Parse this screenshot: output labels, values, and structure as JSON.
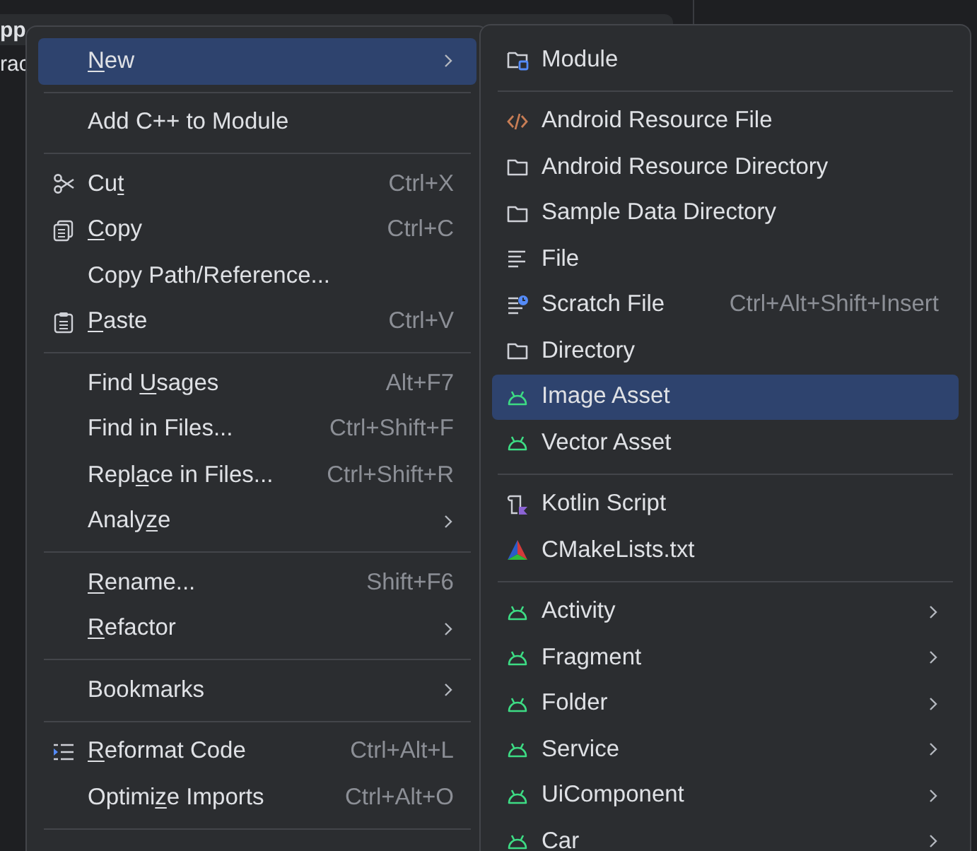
{
  "background": {
    "texts": [
      "pp",
      "rac"
    ]
  },
  "context_menu": {
    "items": [
      {
        "kind": "plain",
        "mnemonic": "N",
        "label_after": "ew",
        "selected": true,
        "submenu": true
      },
      {
        "kind": "separator"
      },
      {
        "kind": "plain",
        "label": "Add C++ to Module",
        "selected": false
      },
      {
        "kind": "separator"
      },
      {
        "kind": "scissors",
        "label_before": "Cu",
        "mnemonic": "t",
        "shortcut": "Ctrl+X",
        "selected": false
      },
      {
        "kind": "copy",
        "mnemonic": "C",
        "label_after": "opy",
        "shortcut": "Ctrl+C",
        "selected": false
      },
      {
        "kind": "plain",
        "label": "Copy Path/Reference...",
        "selected": false
      },
      {
        "kind": "clipboard",
        "mnemonic": "P",
        "label_after": "aste",
        "shortcut": "Ctrl+V",
        "selected": false
      },
      {
        "kind": "separator"
      },
      {
        "kind": "plain",
        "label_before": "Find ",
        "mnemonic": "U",
        "label_after": "sages",
        "shortcut": "Alt+F7",
        "selected": false
      },
      {
        "kind": "plain",
        "label": "Find in Files...",
        "shortcut": "Ctrl+Shift+F",
        "selected": false
      },
      {
        "kind": "plain",
        "label_before": "Repl",
        "mnemonic": "a",
        "label_after": "ce in Files...",
        "shortcut": "Ctrl+Shift+R",
        "selected": false
      },
      {
        "kind": "plain",
        "label_before": "Analy",
        "mnemonic": "z",
        "label_after": "e",
        "selected": false,
        "submenu": true
      },
      {
        "kind": "separator"
      },
      {
        "kind": "plain",
        "mnemonic": "R",
        "label_after": "ename...",
        "shortcut": "Shift+F6",
        "selected": false
      },
      {
        "kind": "plain",
        "mnemonic": "R",
        "label_after": "efactor",
        "selected": false,
        "submenu": true
      },
      {
        "kind": "separator"
      },
      {
        "kind": "plain",
        "label": "Bookmarks",
        "selected": false,
        "submenu": true
      },
      {
        "kind": "separator"
      },
      {
        "kind": "indent",
        "mnemonic": "R",
        "label_after": "eformat Code",
        "shortcut": "Ctrl+Alt+L",
        "selected": false
      },
      {
        "kind": "plain",
        "label_before": "Optimi",
        "mnemonic": "z",
        "label_after": "e Imports",
        "shortcut": "Ctrl+Alt+O",
        "selected": false
      },
      {
        "kind": "separator"
      }
    ]
  },
  "new_submenu": {
    "items": [
      {
        "kind": "module",
        "label": "Module",
        "selected": false
      },
      {
        "kind": "separator"
      },
      {
        "kind": "code",
        "label": "Android Resource File",
        "selected": false
      },
      {
        "kind": "folder",
        "label": "Android Resource Directory",
        "selected": false
      },
      {
        "kind": "folder",
        "label": "Sample Data Directory",
        "selected": false
      },
      {
        "kind": "file",
        "label": "File",
        "selected": false
      },
      {
        "kind": "scratch",
        "label": "Scratch File",
        "shortcut": "Ctrl+Alt+Shift+Insert",
        "selected": false
      },
      {
        "kind": "folder",
        "label": "Directory",
        "selected": false
      },
      {
        "kind": "android",
        "label": "Image Asset",
        "selected": true
      },
      {
        "kind": "android",
        "label": "Vector Asset",
        "selected": false
      },
      {
        "kind": "separator"
      },
      {
        "kind": "script",
        "label": "Kotlin Script",
        "selected": false
      },
      {
        "kind": "triangle",
        "label": "CMakeLists.txt",
        "selected": false
      },
      {
        "kind": "separator"
      },
      {
        "kind": "android",
        "label": "Activity",
        "selected": false,
        "submenu": true
      },
      {
        "kind": "android",
        "label": "Fragment",
        "selected": false,
        "submenu": true
      },
      {
        "kind": "android",
        "label": "Folder",
        "selected": false,
        "submenu": true
      },
      {
        "kind": "android",
        "label": "Service",
        "selected": false,
        "submenu": true
      },
      {
        "kind": "android",
        "label": "UiComponent",
        "selected": false,
        "submenu": true
      },
      {
        "kind": "android",
        "label": "Car",
        "selected": false,
        "submenu": true
      }
    ]
  }
}
